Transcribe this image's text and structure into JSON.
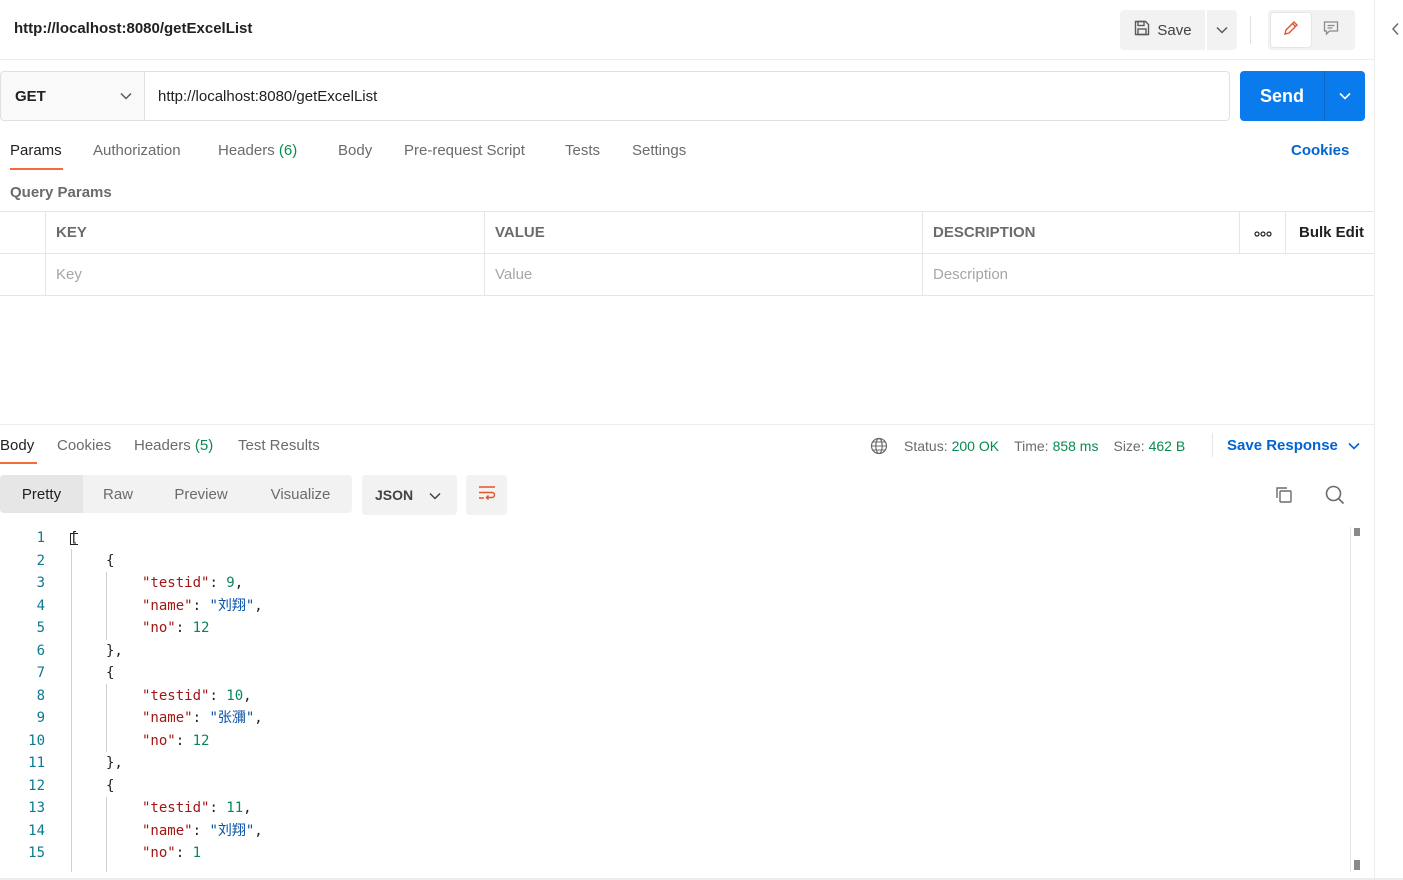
{
  "header": {
    "request_title": "http://localhost:8080/getExcelList",
    "save_label": "Save"
  },
  "request": {
    "method": "GET",
    "url": "http://localhost:8080/getExcelList",
    "send_label": "Send"
  },
  "request_tabs": {
    "params": "Params",
    "authorization": "Authorization",
    "headers": "Headers",
    "headers_count": "(6)",
    "body": "Body",
    "pre_request": "Pre-request Script",
    "tests": "Tests",
    "settings": "Settings",
    "cookies": "Cookies"
  },
  "query_params": {
    "title": "Query Params",
    "columns": [
      "KEY",
      "VALUE",
      "DESCRIPTION"
    ],
    "bulk_edit": "Bulk Edit",
    "placeholders": [
      "Key",
      "Value",
      "Description"
    ]
  },
  "response_tabs": {
    "body": "Body",
    "cookies": "Cookies",
    "headers": "Headers",
    "headers_count": "(5)",
    "test_results": "Test Results"
  },
  "response_status": {
    "status_label": "Status:",
    "status_value": "200 OK",
    "time_label": "Time:",
    "time_value": "858 ms",
    "size_label": "Size:",
    "size_value": "462 B",
    "save_response": "Save Response"
  },
  "view_tabs": [
    "Pretty",
    "Raw",
    "Preview",
    "Visualize"
  ],
  "format": "JSON",
  "code_lines": [
    {
      "n": "1",
      "indent": 0,
      "parts": [
        [
          "p",
          "["
        ]
      ]
    },
    {
      "n": "2",
      "indent": 1,
      "parts": [
        [
          "p",
          "{"
        ]
      ]
    },
    {
      "n": "3",
      "indent": 2,
      "parts": [
        [
          "k",
          "\"testid\""
        ],
        [
          "p",
          ": "
        ],
        [
          "n",
          "9"
        ],
        [
          "p",
          ","
        ]
      ]
    },
    {
      "n": "4",
      "indent": 2,
      "parts": [
        [
          "k",
          "\"name\""
        ],
        [
          "p",
          ": "
        ],
        [
          "s",
          "\"刘翔\""
        ],
        [
          "p",
          ","
        ]
      ]
    },
    {
      "n": "5",
      "indent": 2,
      "parts": [
        [
          "k",
          "\"no\""
        ],
        [
          "p",
          ": "
        ],
        [
          "n",
          "12"
        ]
      ]
    },
    {
      "n": "6",
      "indent": 1,
      "parts": [
        [
          "p",
          "},"
        ]
      ]
    },
    {
      "n": "7",
      "indent": 1,
      "parts": [
        [
          "p",
          "{"
        ]
      ]
    },
    {
      "n": "8",
      "indent": 2,
      "parts": [
        [
          "k",
          "\"testid\""
        ],
        [
          "p",
          ": "
        ],
        [
          "n",
          "10"
        ],
        [
          "p",
          ","
        ]
      ]
    },
    {
      "n": "9",
      "indent": 2,
      "parts": [
        [
          "k",
          "\"name\""
        ],
        [
          "p",
          ": "
        ],
        [
          "s",
          "\"张瀰\""
        ],
        [
          "p",
          ","
        ]
      ]
    },
    {
      "n": "10",
      "indent": 2,
      "parts": [
        [
          "k",
          "\"no\""
        ],
        [
          "p",
          ": "
        ],
        [
          "n",
          "12"
        ]
      ]
    },
    {
      "n": "11",
      "indent": 1,
      "parts": [
        [
          "p",
          "},"
        ]
      ]
    },
    {
      "n": "12",
      "indent": 1,
      "parts": [
        [
          "p",
          "{"
        ]
      ]
    },
    {
      "n": "13",
      "indent": 2,
      "parts": [
        [
          "k",
          "\"testid\""
        ],
        [
          "p",
          ": "
        ],
        [
          "n",
          "11"
        ],
        [
          "p",
          ","
        ]
      ]
    },
    {
      "n": "14",
      "indent": 2,
      "parts": [
        [
          "k",
          "\"name\""
        ],
        [
          "p",
          ": "
        ],
        [
          "s",
          "\"刘翔\""
        ],
        [
          "p",
          ","
        ]
      ]
    },
    {
      "n": "15",
      "indent": 2,
      "parts": [
        [
          "k",
          "\"no\""
        ],
        [
          "p",
          ": "
        ],
        [
          "n",
          "1"
        ]
      ]
    }
  ],
  "colors": {
    "accent_orange": "#f26b3a",
    "send_blue": "#097bed",
    "link_blue": "#0265d2",
    "status_green": "#0a8a4f"
  },
  "icons": [
    "save-icon",
    "chevron-down-icon",
    "pencil-icon",
    "comment-icon",
    "globe-icon",
    "wrap-lines-icon",
    "copy-icon",
    "search-icon",
    "more-icon",
    "chevron-left-icon"
  ]
}
